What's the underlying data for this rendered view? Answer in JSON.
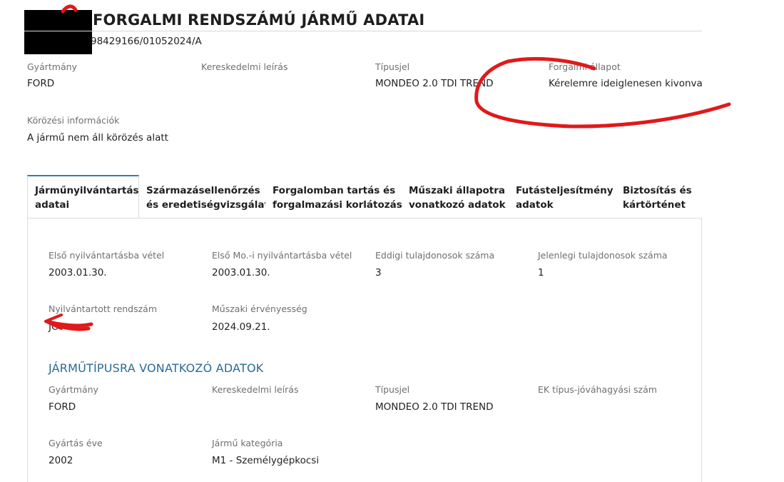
{
  "header": {
    "title": "FORGALMI RENDSZÁMÚ JÁRMŰ ADATAI",
    "document_id": "98429166/01052024/A"
  },
  "summary": {
    "manufacturer_label": "Gyártmány",
    "manufacturer_value": "FORD",
    "commercial_label": "Kereskedelmi leírás",
    "commercial_value": "",
    "type_label": "Típusjel",
    "type_value": "MONDEO 2.0 TDI TREND",
    "traffic_status_label": "Forgalmi állapot",
    "traffic_status_value": "Kérelemre ideiglenesen kivonva",
    "wanted_label": "Körözési információk",
    "wanted_value": "A jármű nem áll körözés alatt"
  },
  "tabs": [
    {
      "line1": "Járműnyilvántartás",
      "line2": "adatai",
      "active": true
    },
    {
      "line1": "Származásellenőrzés",
      "line2": "és eredetiségvizsgálat",
      "active": false
    },
    {
      "line1": "Forgalomban tartás és",
      "line2": "forgalmazási korlátozás",
      "active": false
    },
    {
      "line1": "Műszaki állapotra",
      "line2": "vonatkozó adatok",
      "active": false
    },
    {
      "line1": "Futásteljesítmény",
      "line2": "adatok",
      "active": false
    },
    {
      "line1": "Biztosítás és",
      "line2": "kártörténet",
      "active": false
    }
  ],
  "registration": {
    "first_reg_label": "Első nyilvántartásba vétel",
    "first_reg_value": "2003.01.30.",
    "first_hu_reg_label": "Első Mo.-i nyilvántartásba vétel",
    "first_hu_reg_value": "2003.01.30.",
    "prev_owners_label": "Eddigi tulajdonosok száma",
    "prev_owners_value": "3",
    "curr_owners_label": "Jelenlegi tulajdonosok száma",
    "curr_owners_value": "1",
    "plate_label": "Nyilvántartott rendszám",
    "plate_value": "JO",
    "tech_validity_label": "Műszaki érvényesség",
    "tech_validity_value": "2024.09.21."
  },
  "vehicle_type": {
    "section_title": "JÁRMŰTÍPUSRA VONATKOZÓ ADATOK",
    "manufacturer_label": "Gyártmány",
    "manufacturer_value": "FORD",
    "commercial_label": "Kereskedelmi leírás",
    "commercial_value": "",
    "type_label": "Típusjel",
    "type_value": "MONDEO 2.0 TDI TREND",
    "ek_label": "EK típus-jóváhagyási szám",
    "ek_value": "",
    "year_label": "Gyártás éve",
    "year_value": "2002",
    "category_label": "Jármű kategória",
    "category_value": "M1 - Személygépkocsi"
  },
  "colors": {
    "accent": "#2f7fa6",
    "section_title": "#2a6a96",
    "annotation_red": "#e0191b"
  }
}
